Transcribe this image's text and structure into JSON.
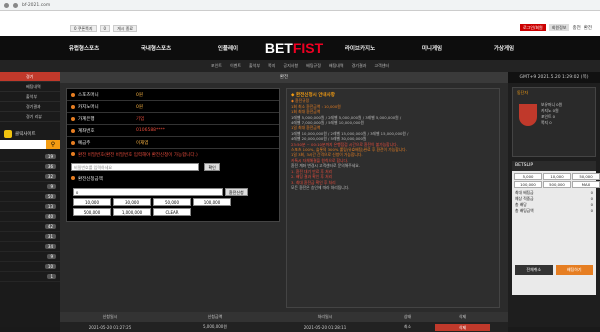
{
  "browser": {
    "url": "bf-2021.com",
    "tab_hint": "무인 유틸"
  },
  "top": {
    "login_hint": "0 쿠폰쪽지",
    "btn1": "0",
    "btn2": "게시 종료",
    "right_links": [
      "로그인/회원",
      "회원정보",
      "충전",
      "환전"
    ]
  },
  "nav": {
    "menus": [
      "유럽형스포츠",
      "국내형스포츠",
      "인플레이",
      "라이브카지노",
      "미니게임",
      "가상게임"
    ]
  },
  "logo": {
    "a": "BET",
    "b": "FIST"
  },
  "subnav": [
    "포인트",
    "이벤트",
    "출석부",
    "쪽지",
    "공지사항",
    "배팅규정",
    "배팅내역",
    "경기결과",
    "고객센터"
  ],
  "left": {
    "items": [
      "경기",
      "베팅내역",
      "출석부",
      "경기결과",
      "경기 리뷰"
    ],
    "live": "클릭사이트",
    "nums": [
      "19",
      "36",
      "32",
      "9",
      "50",
      "13",
      "40",
      "42",
      "31",
      "34",
      "9",
      "10",
      "1"
    ]
  },
  "page": {
    "title": "환전"
  },
  "form": {
    "rows": [
      {
        "label": "스포츠머니",
        "value": "0원"
      },
      {
        "label": "카지노머니",
        "value": "0원"
      },
      {
        "label": "가계은행",
        "value": "기업"
      },
      {
        "label": "계좌번호",
        "value": "0106588****"
      },
      {
        "label": "예금주",
        "value": "이재엽"
      }
    ],
    "pw_label": "환전 비밀번호(환전 비밀번호 입력해야 환전신청이 가능합니다.)",
    "pw_placeholder": "비밀번호를 입력하세요",
    "pw_btn": "확인",
    "amount_label": "환전신청금액",
    "amount_value": "0",
    "amount_reset": "환전신청",
    "chips": [
      "10,000",
      "30,000",
      "50,000",
      "100,000",
      "500,000",
      "1,000,000",
      "CLEAR"
    ]
  },
  "info": {
    "head": "환전신청시 안내사항",
    "sub": "환전규정",
    "lines": [
      "1회 최소 환전금액 : 10,000원",
      "1회 최대 환전금액",
      "1레벨 5,000,000원 / 2레벨 5,000,000원 / 3레벨 5,000,000원 /",
      "4레벨 7,000,000원 / 5레벨 10,000,000원",
      "1일 최대 환전금액",
      "1레벨 10,000,000원 / 2레벨 15,000,000원 / 3레벨 15,000,000원 /",
      "4레벨 20,000,000원 / 5레벨 30,000,000원",
      "23:50분 ~ 00:10분까지 은행점검 시간으로 환전이 불가능합니다.",
      "스포츠 100%, 슬롯의 300% 롤링(유효배팅)완료 후 환전이 가능합니다.",
      "1일 3회, 3시간 간격으로 신청이 가능합니다.",
      "카톡시 자체해결을 원칙으로 합니다.",
      "환전 계좌 변경시 고객센터로 문의해주세요.",
      "1. 환전 대기 만료 후 처리",
      "2. 배팅 결과 확인 후 처리",
      "3. 최대 환전금 확인 후 처리",
      "모든 환전은 승인에 따라 처리됩니다."
    ]
  },
  "history": {
    "headers": [
      "신청일시",
      "신청금액",
      "처리일시",
      "상태",
      "삭제"
    ],
    "row": {
      "date": "2021-05-20 01:27:25",
      "amount": "5,000,000원",
      "done": "2021-05-20 01:28:11",
      "status": "최소",
      "del": "삭제"
    }
  },
  "right": {
    "clock": "GMT+9 2021.5.20 1:29:02 (목)",
    "card_cap": "동단자",
    "card_lines": [
      "보유머니 0원",
      "카지노 0원",
      "포인트 0",
      "쪽지 0"
    ],
    "betslip_title": "BETSLIP",
    "chips": [
      "5,000",
      "10,000",
      "50,000",
      "100,000",
      "500,000",
      "MAX"
    ],
    "kv": [
      [
        "최대 배팅금",
        "0"
      ],
      [
        "예상 적중금",
        "0"
      ],
      [
        "총 배당",
        "0"
      ],
      [
        "총 배팅금액",
        "0"
      ]
    ],
    "actions": [
      "전체취소",
      "배팅하기"
    ]
  }
}
